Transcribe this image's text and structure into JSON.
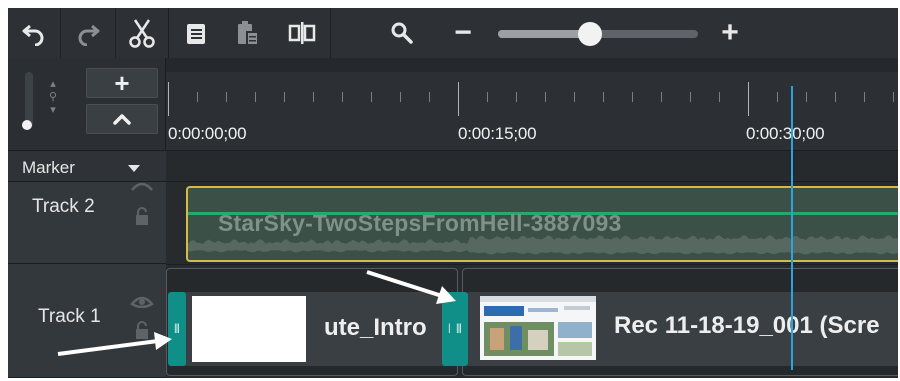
{
  "toolbar": {
    "undo_icon": "undo-icon",
    "redo_icon": "redo-icon",
    "cut_icon": "scissors-icon",
    "copy_icon": "copy-icon",
    "paste_icon": "paste-icon",
    "split_icon": "split-icon",
    "search_icon": "magnifier-icon",
    "zoom_out_label": "−",
    "zoom_in_label": "+",
    "zoom_level": 0.46
  },
  "left_panel": {
    "add_track_label": "+",
    "collapse_label": "^",
    "marker_label": "Marker",
    "tracks": [
      {
        "name": "Track 2"
      },
      {
        "name": "Track 1"
      }
    ]
  },
  "ruler": {
    "timecodes": [
      "0:00:00;00",
      "0:00:15;00",
      "0:00:30;00"
    ]
  },
  "clips": {
    "audio_label": "StarSky-TwoStepsFromHell-3887093",
    "intro_label": "ute_Intro",
    "rec_label": "Rec 11-18-19_001 (Scre"
  },
  "colors": {
    "toolbar_bg": "#2d3135",
    "audio_border": "#d9b84a",
    "audio_line": "#27a96b",
    "handle": "#0f8f87",
    "playhead": "#2ba3de"
  }
}
